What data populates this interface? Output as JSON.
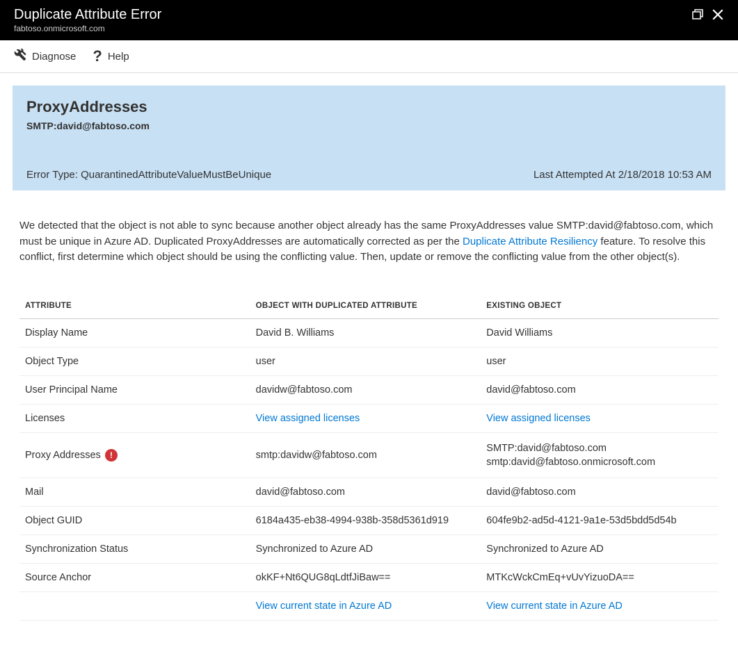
{
  "header": {
    "title": "Duplicate Attribute Error",
    "subtitle": "fabtoso.onmicrosoft.com"
  },
  "toolbar": {
    "diagnose": "Diagnose",
    "help": "Help"
  },
  "infobox": {
    "title": "ProxyAddresses",
    "subtitle": "SMTP:david@fabtoso.com",
    "error_type_label": "Error Type: QuarantinedAttributeValueMustBeUnique",
    "last_attempted": "Last Attempted At 2/18/2018 10:53 AM"
  },
  "description": {
    "text_before_link": "We detected that the object is not able to sync because another object already has the same ProxyAddresses value SMTP:david@fabtoso.com, which must be unique in Azure AD. Duplicated ProxyAddresses are automatically corrected as per the ",
    "link_text": "Duplicate Attribute Resiliency",
    "text_after_link": " feature. To resolve this conflict, first determine which object should be using the conflicting value. Then, update or remove the conflicting value from the other object(s)."
  },
  "table": {
    "headers": {
      "attribute": "ATTRIBUTE",
      "duplicated": "OBJECT WITH DUPLICATED ATTRIBUTE",
      "existing": "EXISTING OBJECT"
    },
    "rows": [
      {
        "attribute": "Display Name",
        "dup": {
          "type": "text",
          "value": "David B. Williams"
        },
        "exist": {
          "type": "text",
          "value": "David Williams"
        }
      },
      {
        "attribute": "Object Type",
        "dup": {
          "type": "text",
          "value": "user"
        },
        "exist": {
          "type": "text",
          "value": "user"
        }
      },
      {
        "attribute": "User Principal Name",
        "dup": {
          "type": "text",
          "value": "davidw@fabtoso.com"
        },
        "exist": {
          "type": "text",
          "value": "david@fabtoso.com"
        }
      },
      {
        "attribute": "Licenses",
        "dup": {
          "type": "link",
          "value": "View assigned licenses"
        },
        "exist": {
          "type": "link",
          "value": "View assigned licenses"
        }
      },
      {
        "attribute": "Proxy Addresses",
        "error": true,
        "dup": {
          "type": "text",
          "value": "smtp:davidw@fabtoso.com"
        },
        "exist": {
          "type": "multi",
          "lines": [
            "SMTP:david@fabtoso.com",
            "smtp:david@fabtoso.onmicrosoft.com"
          ]
        }
      },
      {
        "attribute": "Mail",
        "dup": {
          "type": "text",
          "value": "david@fabtoso.com"
        },
        "exist": {
          "type": "text",
          "value": "david@fabtoso.com"
        }
      },
      {
        "attribute": "Object GUID",
        "dup": {
          "type": "text",
          "value": "6184a435-eb38-4994-938b-358d5361d919"
        },
        "exist": {
          "type": "text",
          "value": "604fe9b2-ad5d-4121-9a1e-53d5bdd5d54b"
        }
      },
      {
        "attribute": "Synchronization Status",
        "dup": {
          "type": "text",
          "value": "Synchronized to Azure AD"
        },
        "exist": {
          "type": "text",
          "value": "Synchronized to Azure AD"
        }
      },
      {
        "attribute": "Source Anchor",
        "dup": {
          "type": "text",
          "value": "okKF+Nt6QUG8qLdtfJiBaw=="
        },
        "exist": {
          "type": "text",
          "value": "MTKcWckCmEq+vUvYizuoDA=="
        }
      },
      {
        "attribute": "",
        "dup": {
          "type": "link",
          "value": "View current state in Azure AD"
        },
        "exist": {
          "type": "link",
          "value": "View current state in Azure AD"
        }
      }
    ]
  }
}
